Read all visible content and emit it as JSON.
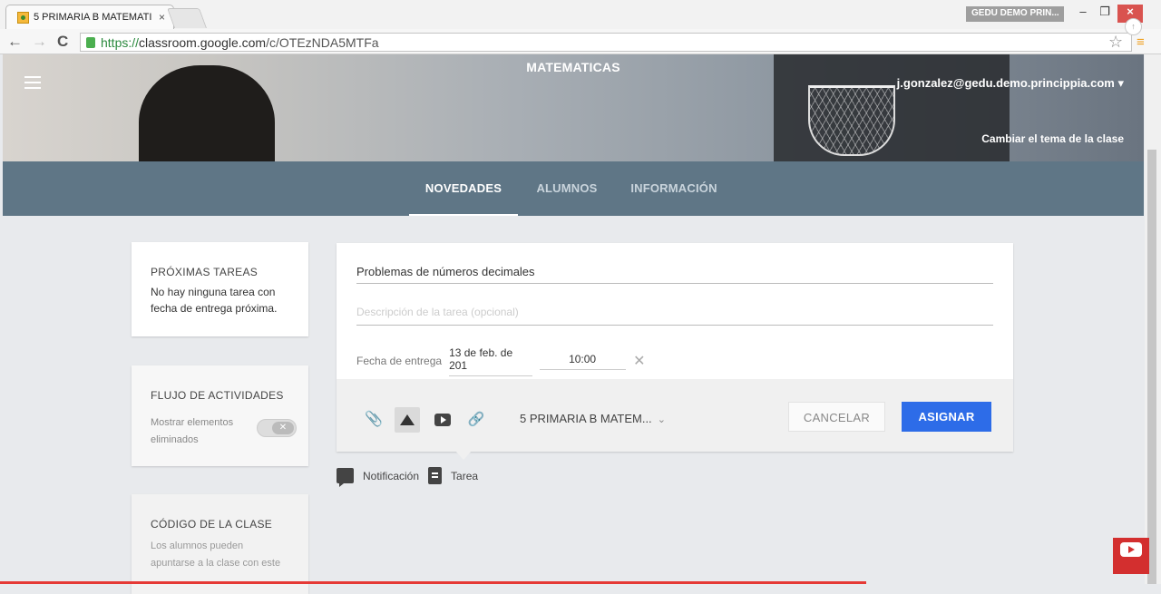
{
  "browser": {
    "tab_title": "5 PRIMARIA B MATEMATI",
    "tab_close": "×",
    "profile_name": "GEDU DEMO PRIN...",
    "win_min": "–",
    "win_max": "❐",
    "win_close": "×",
    "url_scheme": "https://",
    "url_host": "classroom.google.com",
    "url_path": "/c/OTEzNDA5MTFa",
    "back": "←",
    "forward": "→",
    "reload": "C",
    "star": "☆",
    "menu": "≡"
  },
  "header": {
    "class_name": "MATEMATICAS",
    "account": "j.gonzalez@gedu.demo.princippia.com ▾",
    "change_theme": "Cambiar el tema de la clase"
  },
  "tabs": [
    {
      "label": "NOVEDADES",
      "active": true
    },
    {
      "label": "ALUMNOS",
      "active": false
    },
    {
      "label": "INFORMACIÓN",
      "active": false
    }
  ],
  "sidebar": {
    "upcoming_title": "PRÓXIMAS TAREAS",
    "upcoming_text": "No hay ninguna tarea con fecha de entrega próxima.",
    "stream_title": "FLUJO DE ACTIVIDADES",
    "stream_toggle_label": "Mostrar elementos eliminados",
    "stream_toggle_state": "off",
    "toggle_x": "✕",
    "code_title": "CÓDIGO DE LA CLASE",
    "code_text": "Los alumnos pueden apuntarse a la clase con este"
  },
  "assignment": {
    "title_value": "Problemas de números decimales",
    "description_placeholder": "Descripción de la tarea (opcional)",
    "due_label": "Fecha de entrega",
    "due_date": "13 de feb. de 201",
    "due_time": "10:00",
    "clear": "✕",
    "class_select": "5 PRIMARIA B MATEM...",
    "chevron": "⌄",
    "cancel": "CANCELAR",
    "assign": "ASIGNAR"
  },
  "post_types": {
    "announcement": "Notificación",
    "assignment": "Tarea"
  },
  "colors": {
    "accent": "#2d6ce8",
    "tabs_bg": "#5f7686"
  }
}
